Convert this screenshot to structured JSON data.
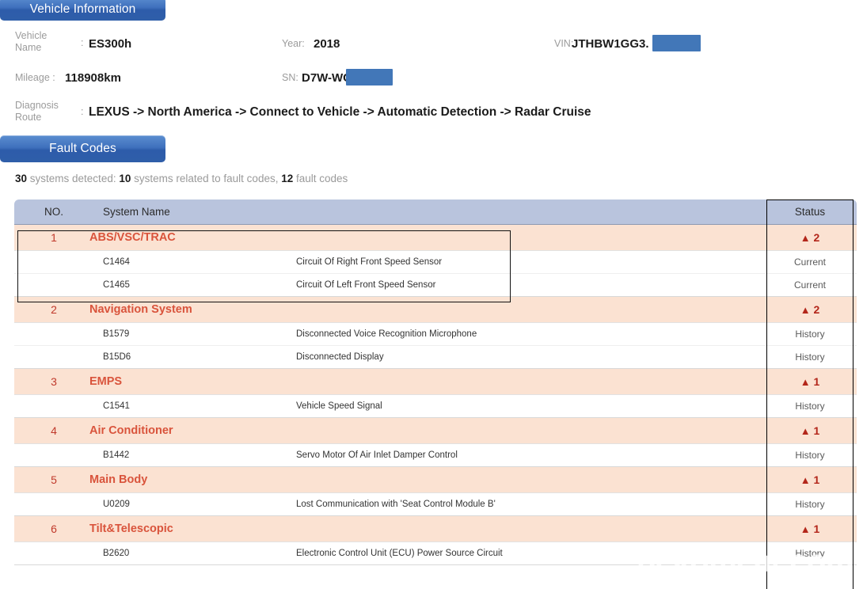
{
  "sections": {
    "vehicle_information_title": "Vehicle Information",
    "fault_codes_title": "Fault Codes"
  },
  "vehicle_info": {
    "vehicle_name_label": "Vehicle\nName",
    "vehicle_name_colon": ":",
    "vehicle_name_value": "ES300h",
    "year_label": "Year:",
    "year_value": "2018",
    "vin_label": "VIN:",
    "vin_value": "JTHBW1GG3.",
    "mileage_label": "Mileage :",
    "mileage_value": "118908km",
    "sn_label": "SN:",
    "sn_value": "D7W-WC",
    "diagnosis_route_label": "Diagnosis\nRoute",
    "diagnosis_route_colon": ":",
    "diagnosis_route_value": "LEXUS -> North America -> Connect to Vehicle -> Automatic Detection -> Radar Cruise"
  },
  "summary": {
    "systems_detected_count": "30",
    "systems_detected_text": " systems detected: ",
    "systems_with_codes_count": "10",
    "systems_with_codes_text": " systems related to fault codes, ",
    "fault_codes_count": "12",
    "fault_codes_text": " fault codes"
  },
  "table": {
    "columns": {
      "no": "NO.",
      "system_name": "System Name",
      "status": "Status"
    },
    "rows": [
      {
        "no": "1",
        "system": "ABS/VSC/TRAC",
        "status": "2",
        "status_icon": "warning-triangle-icon",
        "codes": [
          {
            "code": "C1464",
            "desc": "Circuit Of Right Front Speed Sensor",
            "status": "Current"
          },
          {
            "code": "C1465",
            "desc": "Circuit Of Left Front Speed Sensor",
            "status": "Current"
          }
        ]
      },
      {
        "no": "2",
        "system": "Navigation System",
        "status": "2",
        "status_icon": "warning-triangle-icon",
        "codes": [
          {
            "code": "B1579",
            "desc": "Disconnected Voice Recognition Microphone",
            "status": "History"
          },
          {
            "code": "B15D6",
            "desc": "Disconnected Display",
            "status": "History"
          }
        ]
      },
      {
        "no": "3",
        "system": "EMPS",
        "status": "1",
        "status_icon": "warning-triangle-icon",
        "codes": [
          {
            "code": "C1541",
            "desc": "Vehicle Speed Signal",
            "status": "History"
          }
        ]
      },
      {
        "no": "4",
        "system": "Air Conditioner",
        "status": "1",
        "status_icon": "warning-triangle-icon",
        "codes": [
          {
            "code": "B1442",
            "desc": "Servo Motor Of Air Inlet Damper Control",
            "status": "History"
          }
        ]
      },
      {
        "no": "5",
        "system": "Main Body",
        "status": "1",
        "status_icon": "warning-triangle-icon",
        "codes": [
          {
            "code": "U0209",
            "desc": "Lost Communication with 'Seat Control Module B'",
            "status": "History"
          }
        ]
      },
      {
        "no": "6",
        "system": "Tilt&Telescopic",
        "status": "1",
        "status_icon": "warning-triangle-icon",
        "codes": [
          {
            "code": "B2620",
            "desc": "Electronic Control Unit (ECU) Power Source Circuit",
            "status": "History"
          }
        ]
      }
    ]
  },
  "watermark": {
    "text": "bekomcar.com"
  },
  "colors": {
    "bar_blue": "#2f5ea9",
    "header_row": "#b9c4dd",
    "system_row": "#fbe2d2",
    "system_text": "#d9543c",
    "status_red": "#b3261a",
    "redaction": "#4277b8"
  }
}
